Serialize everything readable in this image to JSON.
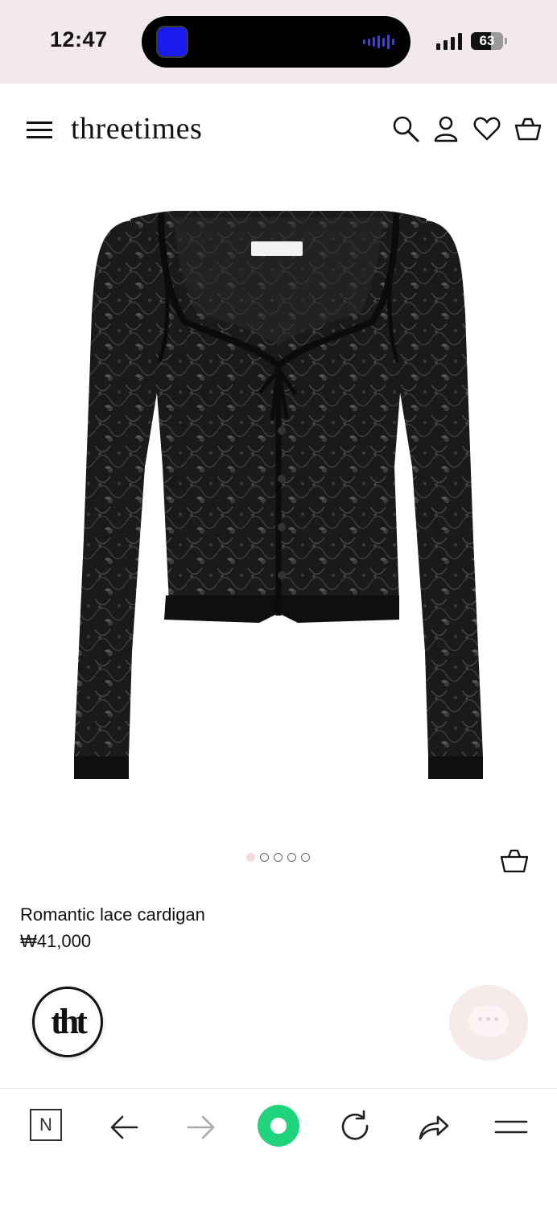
{
  "status_bar": {
    "time": "12:47",
    "battery": "63",
    "battery_level": 0.63,
    "icons": [
      "app-activity-icon",
      "audio-wave-icon",
      "signal-icon",
      "battery-icon"
    ]
  },
  "header": {
    "logo": "threetimes",
    "icons": [
      "menu-icon",
      "search-icon",
      "account-icon",
      "wishlist-heart-icon",
      "cart-bag-icon"
    ]
  },
  "product": {
    "name": "Romantic lace cardigan",
    "price": "₩41,000",
    "image": "black-lace-cardigan",
    "carousel": {
      "total": 5,
      "active_index": 0
    }
  },
  "floating": {
    "brand_badge": "tht",
    "chat_icon": "chat-bubble-icon"
  },
  "browser_toolbar": {
    "items": [
      "naver-n-icon",
      "back-arrow-icon",
      "forward-arrow-icon",
      "home-green-icon",
      "reload-icon",
      "share-icon",
      "menu-icon"
    ],
    "n_label": "N"
  },
  "colors": {
    "status_bg": "#f3e9ea",
    "home_green": "#1fd47c",
    "chat_bg": "#f7eaeb",
    "active_dot": "#f2d9dc"
  }
}
